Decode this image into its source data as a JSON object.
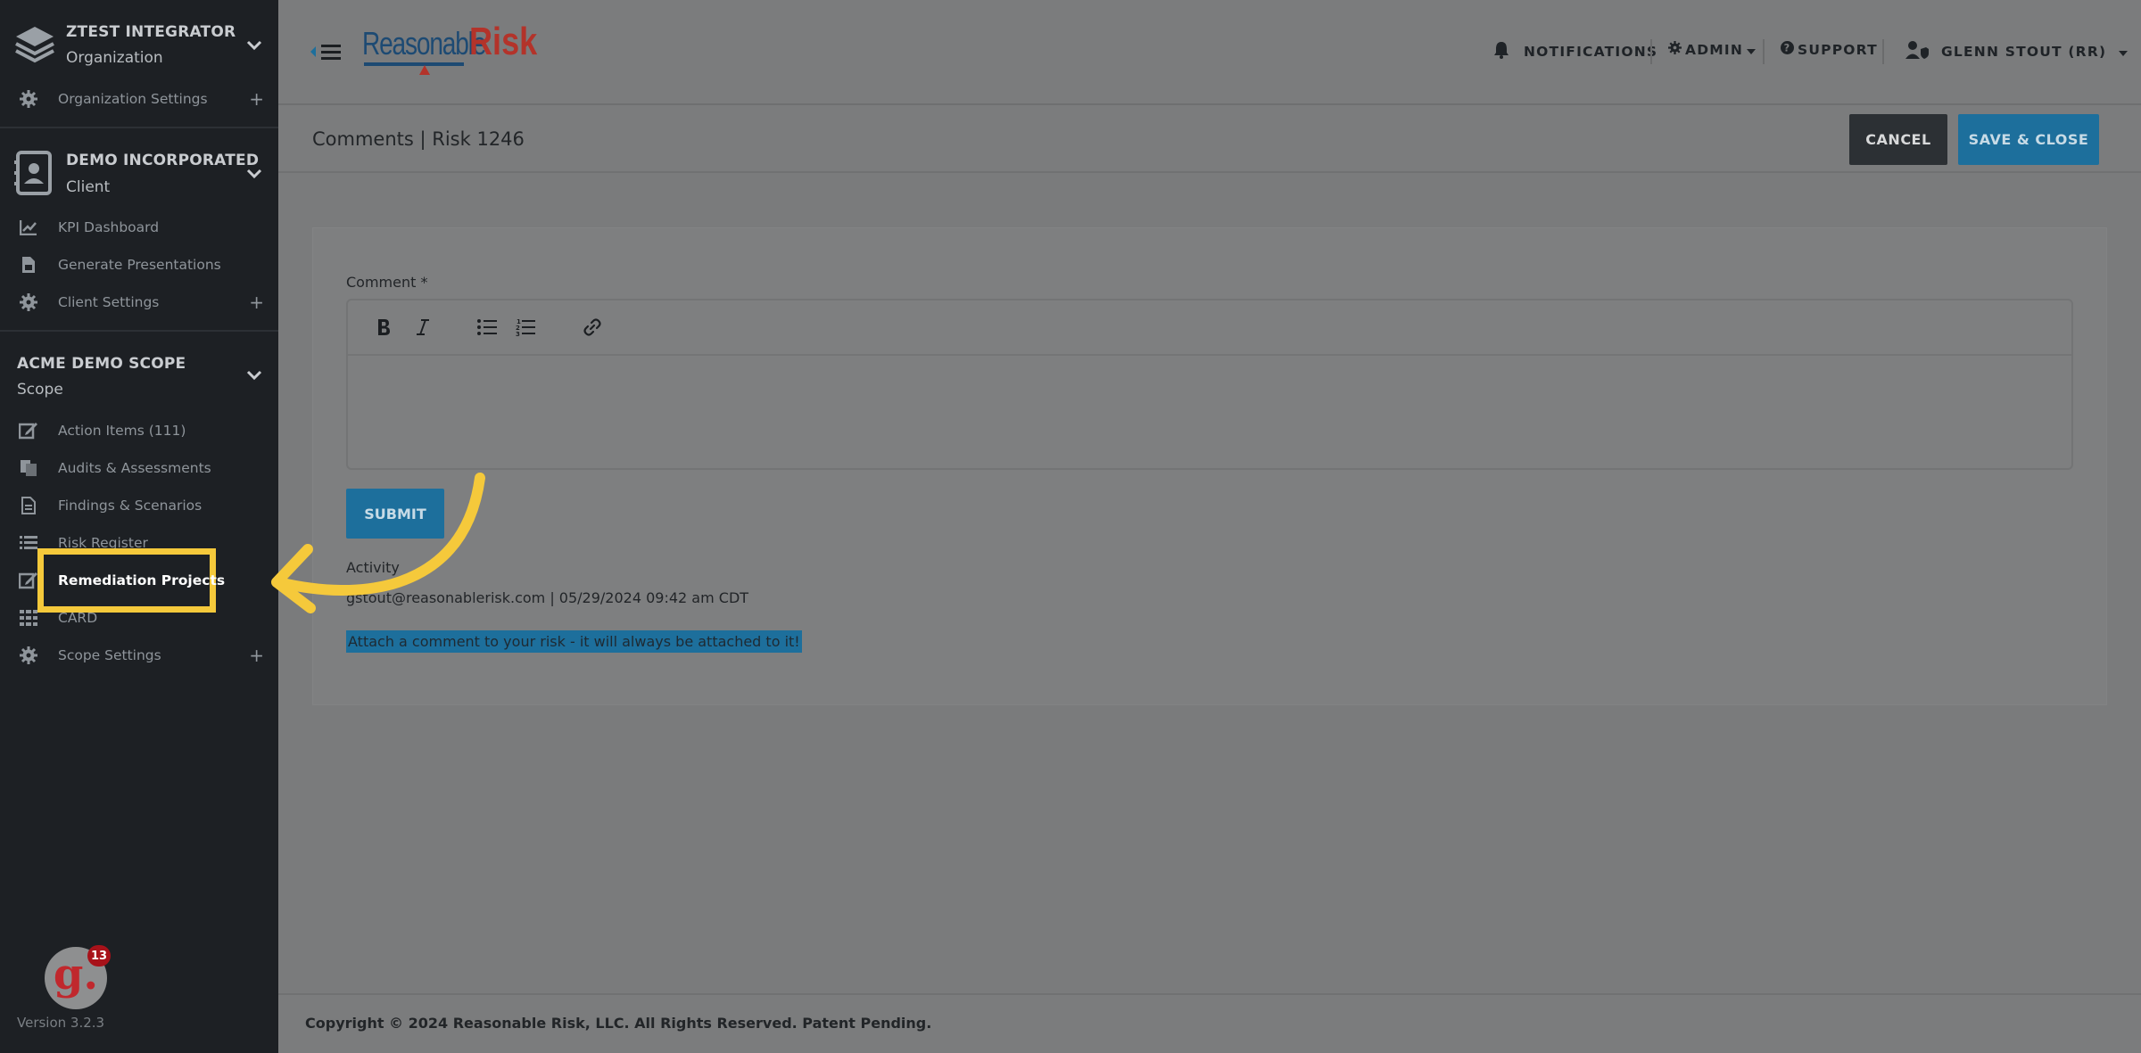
{
  "sidebar": {
    "org": {
      "title": "ZTEST INTEGRATOR",
      "subtitle": "Organization",
      "icon": "layers-icon"
    },
    "org_items": [
      {
        "label": "Organization Settings",
        "icon": "gear-icon",
        "expand": "+"
      }
    ],
    "client": {
      "title": "DEMO INCORPORATED",
      "subtitle": "Client",
      "icon": "contact-book-icon"
    },
    "client_items": [
      {
        "label": "KPI Dashboard",
        "icon": "chart-line-icon"
      },
      {
        "label": "Generate Presentations",
        "icon": "file-icon"
      },
      {
        "label": "Client Settings",
        "icon": "gear-icon",
        "expand": "+"
      }
    ],
    "scope": {
      "title": "ACME DEMO SCOPE",
      "subtitle": "Scope"
    },
    "scope_items": [
      {
        "label": "Action Items (111)",
        "icon": "edit-icon"
      },
      {
        "label": "Audits & Assessments",
        "icon": "copy-icon"
      },
      {
        "label": "Findings & Scenarios",
        "icon": "document-icon"
      },
      {
        "label": "Risk Register",
        "icon": "list-icon"
      },
      {
        "label": "Remediation Projects",
        "icon": "edit-icon"
      },
      {
        "label": "CARD",
        "icon": "grid-icon"
      },
      {
        "label": "Scope Settings",
        "icon": "gear-icon",
        "expand": "+"
      }
    ],
    "badge_count": "13",
    "version": "Version 3.2.3"
  },
  "header": {
    "logo_part1": "Reasonable",
    "logo_part2": "Risk",
    "notifications": "NOTIFICATIONS",
    "admin": "ADMIN",
    "support": "SUPPORT",
    "user": "GLENN STOUT (RR)"
  },
  "page": {
    "title": "Comments | Risk 1246",
    "cancel_label": "CANCEL",
    "save_label": "SAVE & CLOSE"
  },
  "form": {
    "comment_label": "Comment *",
    "comment_value": "",
    "submit_label": "SUBMIT",
    "activity_label": "Activity",
    "activity_meta": "gstout@reasonablerisk.com | 05/29/2024 09:42 am CDT",
    "activity_text": "Attach a comment to your risk - it will always be attached to it!"
  },
  "footer": {
    "text": "Copyright © 2024 Reasonable Risk, LLC. All Rights Reserved. Patent Pending."
  },
  "colors": {
    "accent": "#1d6f9c",
    "highlight": "#f5c93b",
    "sidebar_bg": "#1d2024",
    "dark_button": "#2c3034"
  }
}
